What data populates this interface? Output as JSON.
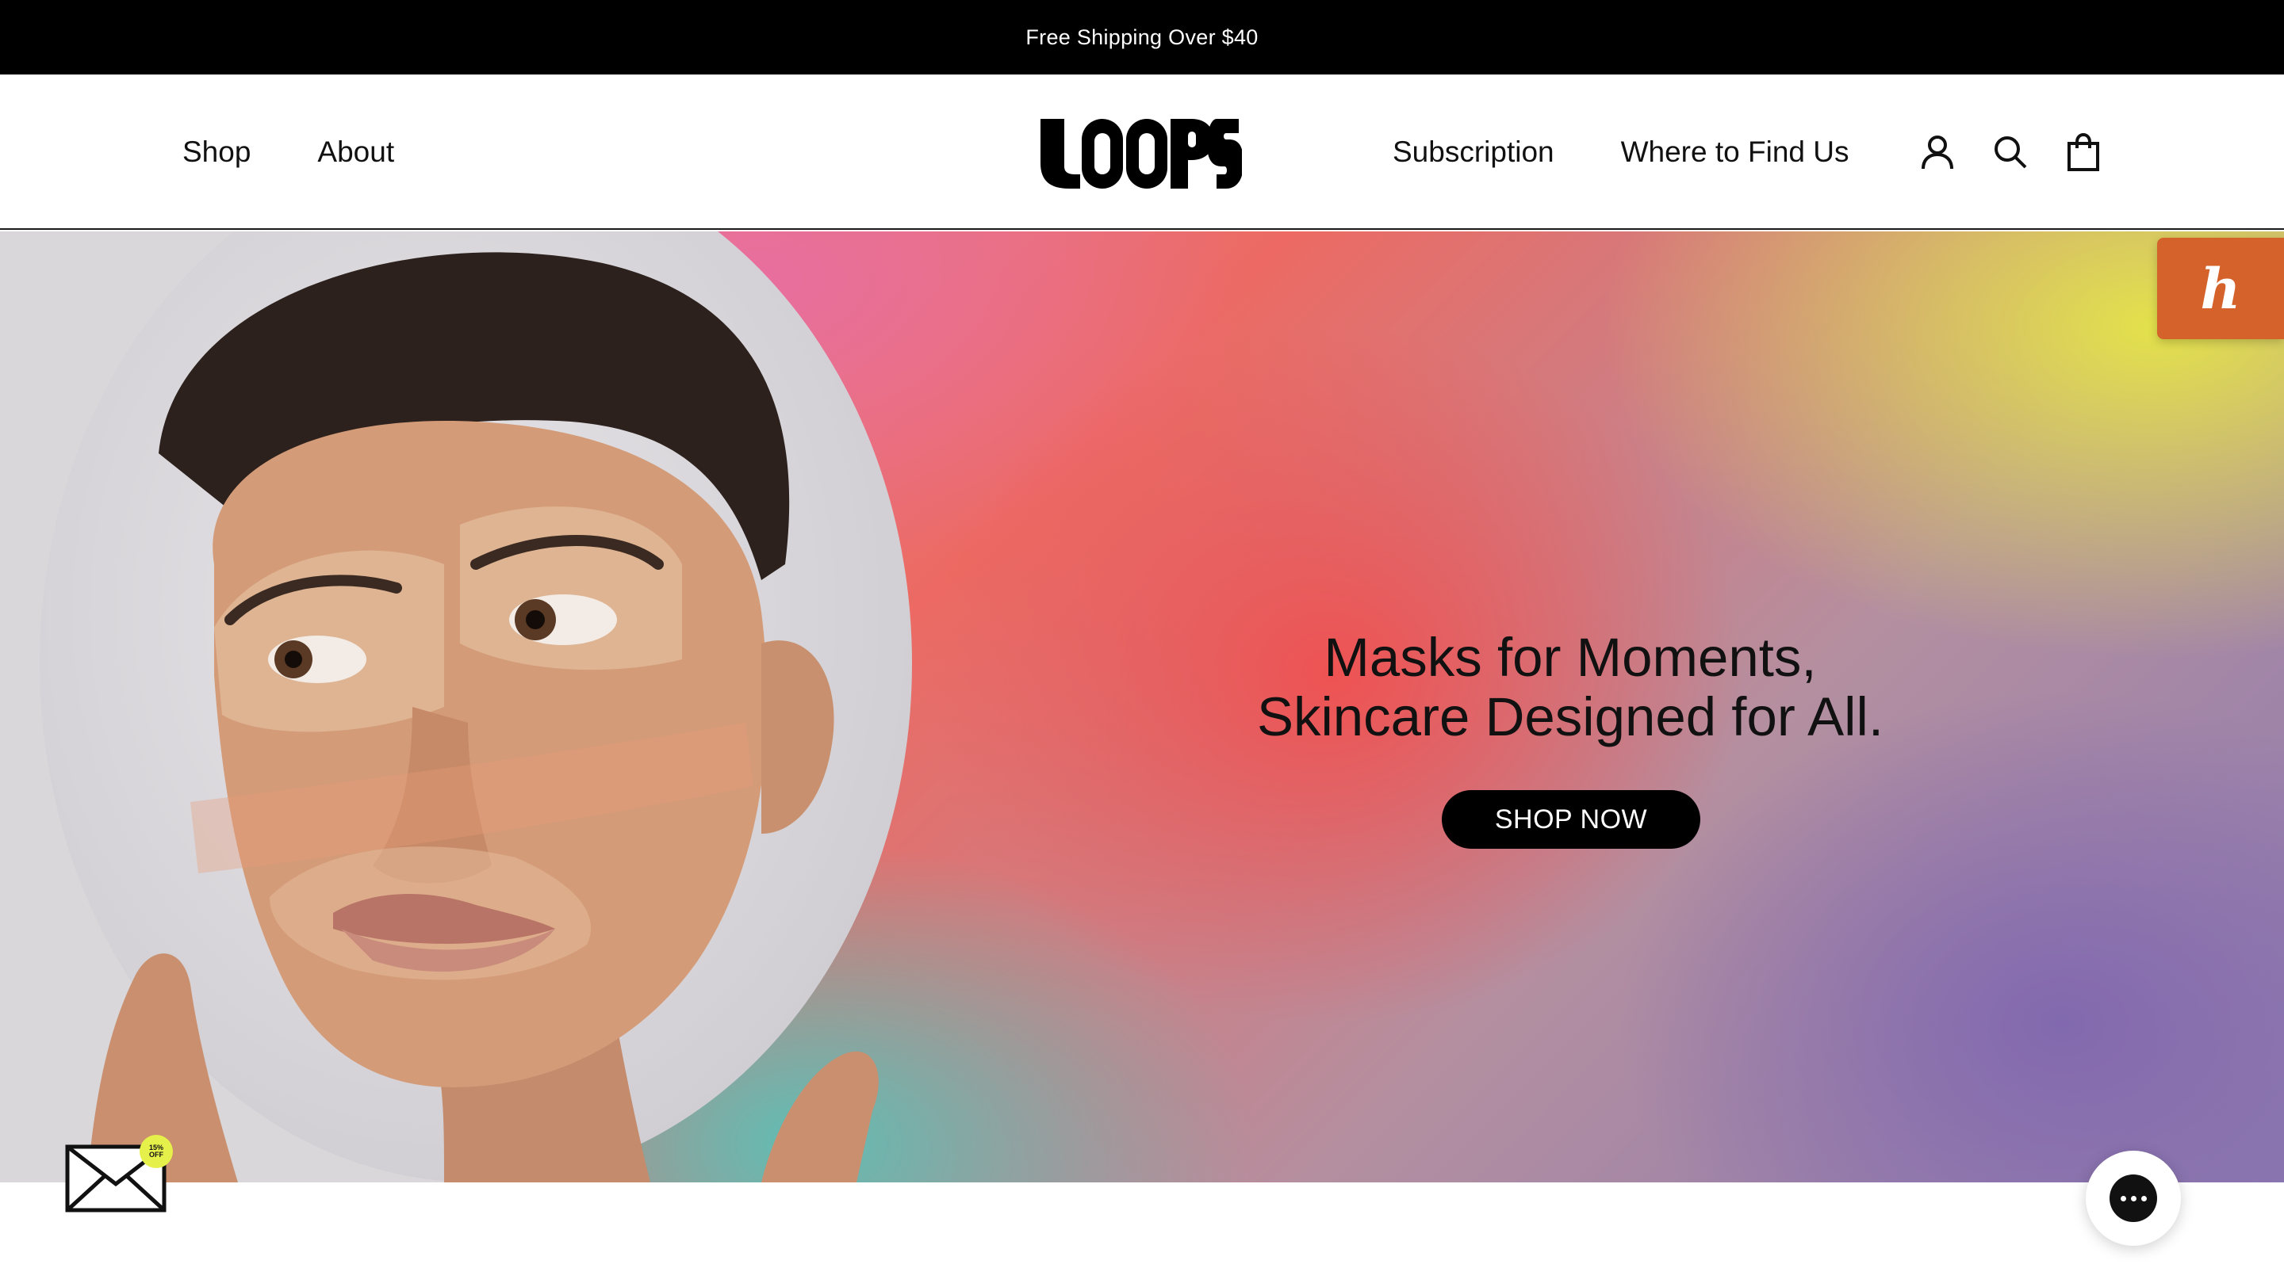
{
  "announcement": {
    "text": "Free Shipping Over $40"
  },
  "header": {
    "logo_text": "LOOPS",
    "nav_left": [
      {
        "label": "Shop"
      },
      {
        "label": "About"
      }
    ],
    "nav_right": [
      {
        "label": "Subscription"
      },
      {
        "label": "Where to Find Us"
      }
    ],
    "icons": [
      "account-icon",
      "search-icon",
      "cart-icon"
    ]
  },
  "hero": {
    "headline_line1": "Masks for Moments,",
    "headline_line2": "Skincare Designed for All.",
    "cta_label": "SHOP NOW"
  },
  "widgets": {
    "honey_label": "h",
    "discount_badge_line1": "15%",
    "discount_badge_line2": "OFF",
    "chat_icon": "chat-bubble-icon"
  },
  "colors": {
    "announcement_bg": "#000000",
    "cta_bg": "#000000",
    "honey_orange": "#d4622a",
    "badge_yellow": "#e6f04a"
  }
}
